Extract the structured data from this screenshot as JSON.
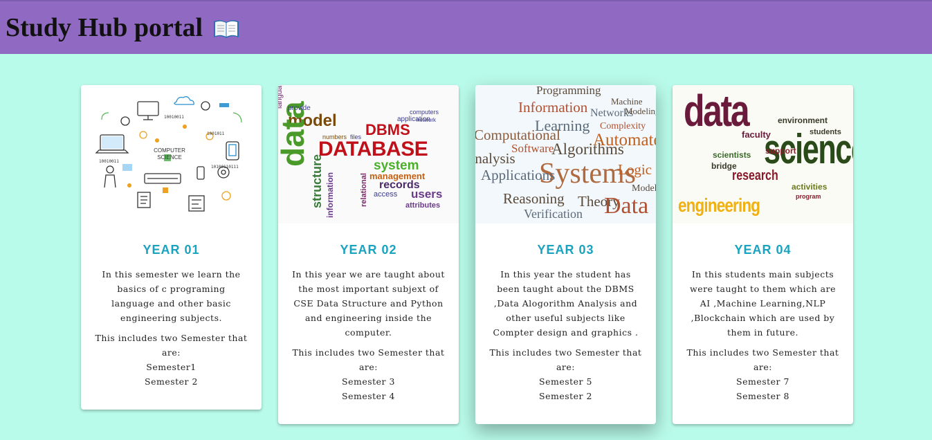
{
  "header": {
    "title": "Study Hub portal"
  },
  "cards": [
    {
      "image_words": [
        "COMPUTER",
        "SCIENCE",
        "10010011",
        "10010011",
        "1001011",
        "10100110111"
      ],
      "year": "YEAR 01",
      "description": "In this semester we learn the basics of c programing language and other basic engineering subjects.",
      "includes": "This includes two Semester that are:",
      "semesters": [
        "Semester1",
        "Semester 2"
      ]
    },
    {
      "image_words": [
        "language",
        "model",
        "data",
        "DBMS",
        "DATABASE",
        "structure",
        "system",
        "management",
        "records",
        "users",
        "attributes",
        "information",
        "relational",
        "application",
        "network",
        "computers",
        "provide",
        "access",
        "numbers",
        "files"
      ],
      "year": "YEAR 02",
      "description": "In this year we are taught about the most important subjext of CSE Data Structure and Python and engineering inside the computer.",
      "includes": "This includes two Semester that are:",
      "semesters": [
        "Semester 3",
        "Semester 4"
      ]
    },
    {
      "image_words": [
        "Programming",
        "Information",
        "Learning",
        "Computational",
        "Algorithms",
        "Automated",
        "Systems",
        "Applications",
        "Reasoning",
        "Verification",
        "Theory",
        "Data",
        "Logic",
        "Models",
        "Networks",
        "Complexity",
        "Software",
        "analysis",
        "Machine",
        "Modeling"
      ],
      "year": "YEAR 03",
      "description": "In this year the student has been taught about the DBMS ,Data Alogorithm Analysis and other useful subjects like Compter design and graphics .",
      "includes": "This includes two Semester that are:",
      "semesters": [
        "Semester 5",
        "Semester 2"
      ]
    },
    {
      "image_words": [
        "data",
        "science",
        "engineering",
        "research",
        "scientists",
        "environment",
        "students",
        "support",
        "activities",
        "faculty",
        "bridge",
        "program"
      ],
      "year": "YEAR 04",
      "description": "In this students main subjects were taught to them which are AI ,Machine Learning,NLP ,Blockchain which are used by them in future.",
      "includes": "This includes two Semester that are:",
      "semesters": [
        "Semester 7",
        "Semester 8"
      ]
    }
  ],
  "icons": {
    "title_icon": "open-book-icon"
  },
  "colors": {
    "header_bg": "#906ac2",
    "page_bg": "#b9fbea",
    "year_heading": "#1aa3be"
  }
}
